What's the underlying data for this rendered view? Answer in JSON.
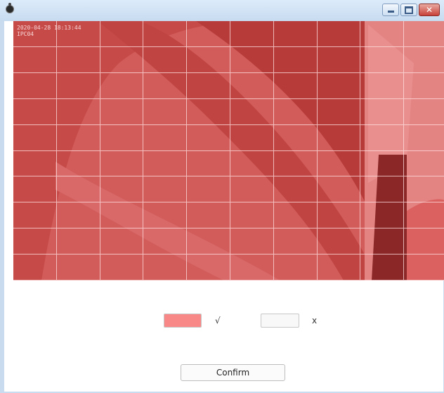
{
  "window": {
    "icon": "camera-icon",
    "controls": [
      {
        "name": "minimize-icon"
      },
      {
        "name": "maximize-icon"
      },
      {
        "name": "close-icon",
        "glyph": "✕"
      }
    ]
  },
  "video": {
    "timestamp": "2020-04-28 18:13:44",
    "channel": "IPC04",
    "overlay_color": "#dc2424",
    "grid_rows": 10,
    "grid_cols": 10
  },
  "legend": {
    "selected": {
      "color": "#f88787",
      "label": "√"
    },
    "unselected": {
      "color": "#f8f8f8",
      "label": "x"
    }
  },
  "confirm_label": "Confirm"
}
